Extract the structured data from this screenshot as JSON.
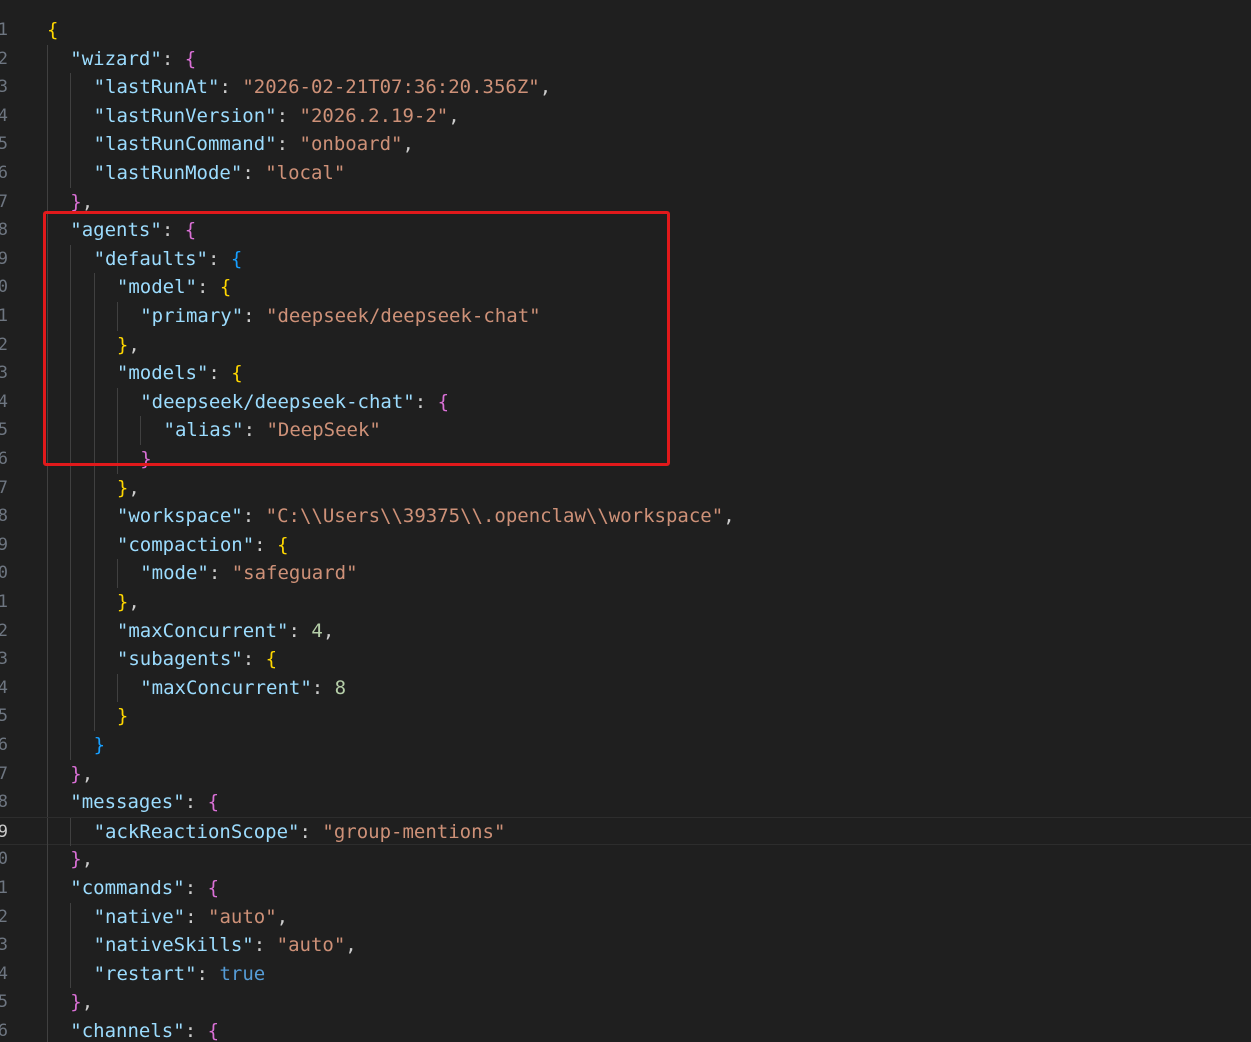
{
  "editor": {
    "language": "json",
    "current_line": 29,
    "line_number_digits": [
      "1",
      "2",
      "3",
      "4",
      "5",
      "6",
      "7",
      "8",
      "9",
      "0",
      "1",
      "2",
      "3",
      "4",
      "5",
      "6",
      "7",
      "8",
      "9",
      "0",
      "1",
      "2",
      "3",
      "4",
      "5",
      "6",
      "7",
      "8",
      "9",
      "0",
      "1",
      "2",
      "3",
      "4",
      "5",
      "6"
    ],
    "highlight": {
      "color": "#e0191b",
      "from_line": 8,
      "to_line": 16
    },
    "colors": {
      "background": "#1f1f1f",
      "key": "#9cdcfe",
      "string": "#ce9178",
      "number": "#b5cea8",
      "boolean": "#569cd6",
      "bracket_level_1": "#ffd700",
      "bracket_level_2": "#da70d6",
      "bracket_level_3": "#179fff"
    },
    "lines": [
      {
        "indent": 0,
        "tokens": [
          {
            "t": "{",
            "c": "br1"
          }
        ]
      },
      {
        "indent": 1,
        "tokens": [
          {
            "t": "\"wizard\"",
            "c": "k"
          },
          {
            "t": ": ",
            "c": "p"
          },
          {
            "t": "{",
            "c": "br2"
          }
        ]
      },
      {
        "indent": 2,
        "tokens": [
          {
            "t": "\"lastRunAt\"",
            "c": "k"
          },
          {
            "t": ": ",
            "c": "p"
          },
          {
            "t": "\"2026-02-21T07:36:20.356Z\"",
            "c": "s"
          },
          {
            "t": ",",
            "c": "p"
          }
        ]
      },
      {
        "indent": 2,
        "tokens": [
          {
            "t": "\"lastRunVersion\"",
            "c": "k"
          },
          {
            "t": ": ",
            "c": "p"
          },
          {
            "t": "\"2026.2.19-2\"",
            "c": "s"
          },
          {
            "t": ",",
            "c": "p"
          }
        ]
      },
      {
        "indent": 2,
        "tokens": [
          {
            "t": "\"lastRunCommand\"",
            "c": "k"
          },
          {
            "t": ": ",
            "c": "p"
          },
          {
            "t": "\"onboard\"",
            "c": "s"
          },
          {
            "t": ",",
            "c": "p"
          }
        ]
      },
      {
        "indent": 2,
        "tokens": [
          {
            "t": "\"lastRunMode\"",
            "c": "k"
          },
          {
            "t": ": ",
            "c": "p"
          },
          {
            "t": "\"local\"",
            "c": "s"
          }
        ]
      },
      {
        "indent": 1,
        "tokens": [
          {
            "t": "}",
            "c": "br2"
          },
          {
            "t": ",",
            "c": "p"
          }
        ]
      },
      {
        "indent": 1,
        "tokens": [
          {
            "t": "\"agents\"",
            "c": "k"
          },
          {
            "t": ": ",
            "c": "p"
          },
          {
            "t": "{",
            "c": "br2"
          }
        ]
      },
      {
        "indent": 2,
        "tokens": [
          {
            "t": "\"defaults\"",
            "c": "k"
          },
          {
            "t": ": ",
            "c": "p"
          },
          {
            "t": "{",
            "c": "br3"
          }
        ]
      },
      {
        "indent": 3,
        "tokens": [
          {
            "t": "\"model\"",
            "c": "k"
          },
          {
            "t": ": ",
            "c": "p"
          },
          {
            "t": "{",
            "c": "br1"
          }
        ]
      },
      {
        "indent": 4,
        "tokens": [
          {
            "t": "\"primary\"",
            "c": "k"
          },
          {
            "t": ": ",
            "c": "p"
          },
          {
            "t": "\"deepseek/deepseek-chat\"",
            "c": "s"
          }
        ]
      },
      {
        "indent": 3,
        "tokens": [
          {
            "t": "}",
            "c": "br1"
          },
          {
            "t": ",",
            "c": "p"
          }
        ]
      },
      {
        "indent": 3,
        "tokens": [
          {
            "t": "\"models\"",
            "c": "k"
          },
          {
            "t": ": ",
            "c": "p"
          },
          {
            "t": "{",
            "c": "br1"
          }
        ]
      },
      {
        "indent": 4,
        "tokens": [
          {
            "t": "\"deepseek/deepseek-chat\"",
            "c": "k"
          },
          {
            "t": ": ",
            "c": "p"
          },
          {
            "t": "{",
            "c": "br2"
          }
        ]
      },
      {
        "indent": 5,
        "tokens": [
          {
            "t": "\"alias\"",
            "c": "k"
          },
          {
            "t": ": ",
            "c": "p"
          },
          {
            "t": "\"DeepSeek\"",
            "c": "s"
          }
        ]
      },
      {
        "indent": 4,
        "tokens": [
          {
            "t": "}",
            "c": "br2"
          }
        ]
      },
      {
        "indent": 3,
        "tokens": [
          {
            "t": "}",
            "c": "br1"
          },
          {
            "t": ",",
            "c": "p"
          }
        ]
      },
      {
        "indent": 3,
        "tokens": [
          {
            "t": "\"workspace\"",
            "c": "k"
          },
          {
            "t": ": ",
            "c": "p"
          },
          {
            "t": "\"C:\\\\Users\\\\39375\\\\.openclaw\\\\workspace\"",
            "c": "s"
          },
          {
            "t": ",",
            "c": "p"
          }
        ]
      },
      {
        "indent": 3,
        "tokens": [
          {
            "t": "\"compaction\"",
            "c": "k"
          },
          {
            "t": ": ",
            "c": "p"
          },
          {
            "t": "{",
            "c": "br1"
          }
        ]
      },
      {
        "indent": 4,
        "tokens": [
          {
            "t": "\"mode\"",
            "c": "k"
          },
          {
            "t": ": ",
            "c": "p"
          },
          {
            "t": "\"safeguard\"",
            "c": "s"
          }
        ]
      },
      {
        "indent": 3,
        "tokens": [
          {
            "t": "}",
            "c": "br1"
          },
          {
            "t": ",",
            "c": "p"
          }
        ]
      },
      {
        "indent": 3,
        "tokens": [
          {
            "t": "\"maxConcurrent\"",
            "c": "k"
          },
          {
            "t": ": ",
            "c": "p"
          },
          {
            "t": "4",
            "c": "n"
          },
          {
            "t": ",",
            "c": "p"
          }
        ]
      },
      {
        "indent": 3,
        "tokens": [
          {
            "t": "\"subagents\"",
            "c": "k"
          },
          {
            "t": ": ",
            "c": "p"
          },
          {
            "t": "{",
            "c": "br1"
          }
        ]
      },
      {
        "indent": 4,
        "tokens": [
          {
            "t": "\"maxConcurrent\"",
            "c": "k"
          },
          {
            "t": ": ",
            "c": "p"
          },
          {
            "t": "8",
            "c": "n"
          }
        ]
      },
      {
        "indent": 3,
        "tokens": [
          {
            "t": "}",
            "c": "br1"
          }
        ]
      },
      {
        "indent": 2,
        "tokens": [
          {
            "t": "}",
            "c": "br3"
          }
        ]
      },
      {
        "indent": 1,
        "tokens": [
          {
            "t": "}",
            "c": "br2"
          },
          {
            "t": ",",
            "c": "p"
          }
        ]
      },
      {
        "indent": 1,
        "tokens": [
          {
            "t": "\"messages\"",
            "c": "k"
          },
          {
            "t": ": ",
            "c": "p"
          },
          {
            "t": "{",
            "c": "br2"
          }
        ]
      },
      {
        "indent": 2,
        "tokens": [
          {
            "t": "\"ackReactionScope\"",
            "c": "k"
          },
          {
            "t": ": ",
            "c": "p"
          },
          {
            "t": "\"group-mentions\"",
            "c": "s"
          }
        ]
      },
      {
        "indent": 1,
        "tokens": [
          {
            "t": "}",
            "c": "br2"
          },
          {
            "t": ",",
            "c": "p"
          }
        ]
      },
      {
        "indent": 1,
        "tokens": [
          {
            "t": "\"commands\"",
            "c": "k"
          },
          {
            "t": ": ",
            "c": "p"
          },
          {
            "t": "{",
            "c": "br2"
          }
        ]
      },
      {
        "indent": 2,
        "tokens": [
          {
            "t": "\"native\"",
            "c": "k"
          },
          {
            "t": ": ",
            "c": "p"
          },
          {
            "t": "\"auto\"",
            "c": "s"
          },
          {
            "t": ",",
            "c": "p"
          }
        ]
      },
      {
        "indent": 2,
        "tokens": [
          {
            "t": "\"nativeSkills\"",
            "c": "k"
          },
          {
            "t": ": ",
            "c": "p"
          },
          {
            "t": "\"auto\"",
            "c": "s"
          },
          {
            "t": ",",
            "c": "p"
          }
        ]
      },
      {
        "indent": 2,
        "tokens": [
          {
            "t": "\"restart\"",
            "c": "k"
          },
          {
            "t": ": ",
            "c": "p"
          },
          {
            "t": "true",
            "c": "b"
          }
        ]
      },
      {
        "indent": 1,
        "tokens": [
          {
            "t": "}",
            "c": "br2"
          },
          {
            "t": ",",
            "c": "p"
          }
        ]
      },
      {
        "indent": 1,
        "tokens": [
          {
            "t": "\"channels\"",
            "c": "k"
          },
          {
            "t": ": ",
            "c": "p"
          },
          {
            "t": "{",
            "c": "br2"
          }
        ]
      }
    ]
  }
}
